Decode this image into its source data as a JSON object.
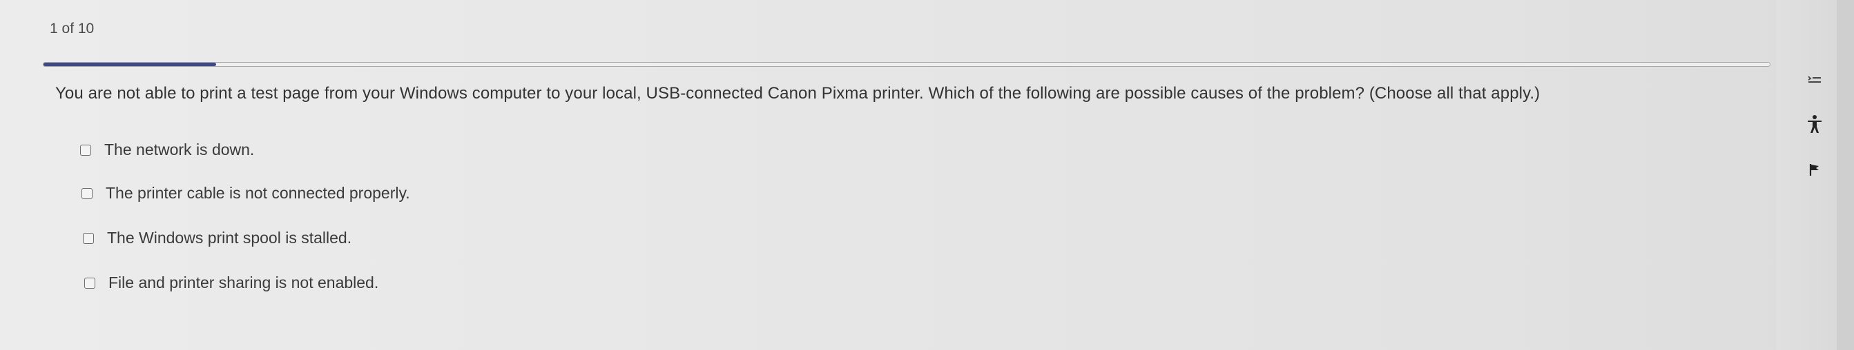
{
  "header": {
    "counter": "1 of 10"
  },
  "progress": {
    "fraction": 0.1,
    "fill_color": "#3d4a86"
  },
  "question": {
    "text": "You are not able to print a test page from your Windows computer to your local, USB-connected Canon Pixma printer. Which of the following are possible causes of the problem? (Choose all that apply.)",
    "options": [
      {
        "label": "The network is down.",
        "checked": false
      },
      {
        "label": "The printer cable is not connected properly.",
        "checked": false
      },
      {
        "label": "The Windows print spool is stalled.",
        "checked": false
      },
      {
        "label": "File and printer sharing is not enabled.",
        "checked": false
      }
    ]
  },
  "sidebar": {
    "icons": [
      "list-settings-icon",
      "accessibility-icon",
      "flag-icon"
    ]
  }
}
